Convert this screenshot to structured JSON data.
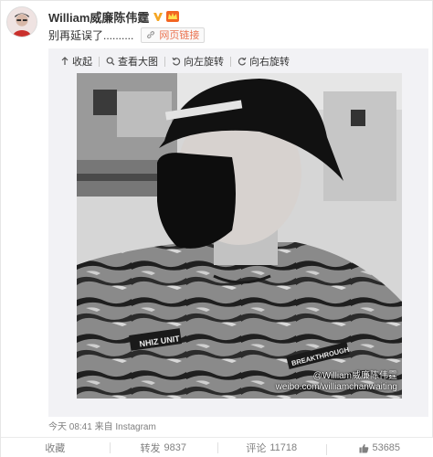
{
  "post": {
    "username": "William威廉陈伟霆",
    "verified_icon": "verified-v-icon",
    "member_icon": "crown-member-icon",
    "text": "别再延误了..........",
    "weblink_label": "网页链接",
    "weblink_icon": "link-icon",
    "meta": "今天 08:41 来自 Instagram"
  },
  "media_toolbar": {
    "collapse_label": "收起",
    "view_large_label": "查看大图",
    "rotate_left_label": "向左旋转",
    "rotate_right_label": "向右旋转"
  },
  "photo": {
    "patch_text": "NHIZ UNIT",
    "brand_text": "BREAKTHROUGH",
    "watermark_line1": "@William威廉陈伟霆",
    "watermark_line2": "weibo.com/williamchanwaiting"
  },
  "footer": {
    "favorite_label": "收藏",
    "repost_label": "转发",
    "repost_count": "9837",
    "comment_label": "评论",
    "comment_count": "11718",
    "like_count": "53685"
  },
  "colors": {
    "link_orange": "#eb7350",
    "muted_gray": "#808080",
    "verified_gold": "#f5a623"
  }
}
